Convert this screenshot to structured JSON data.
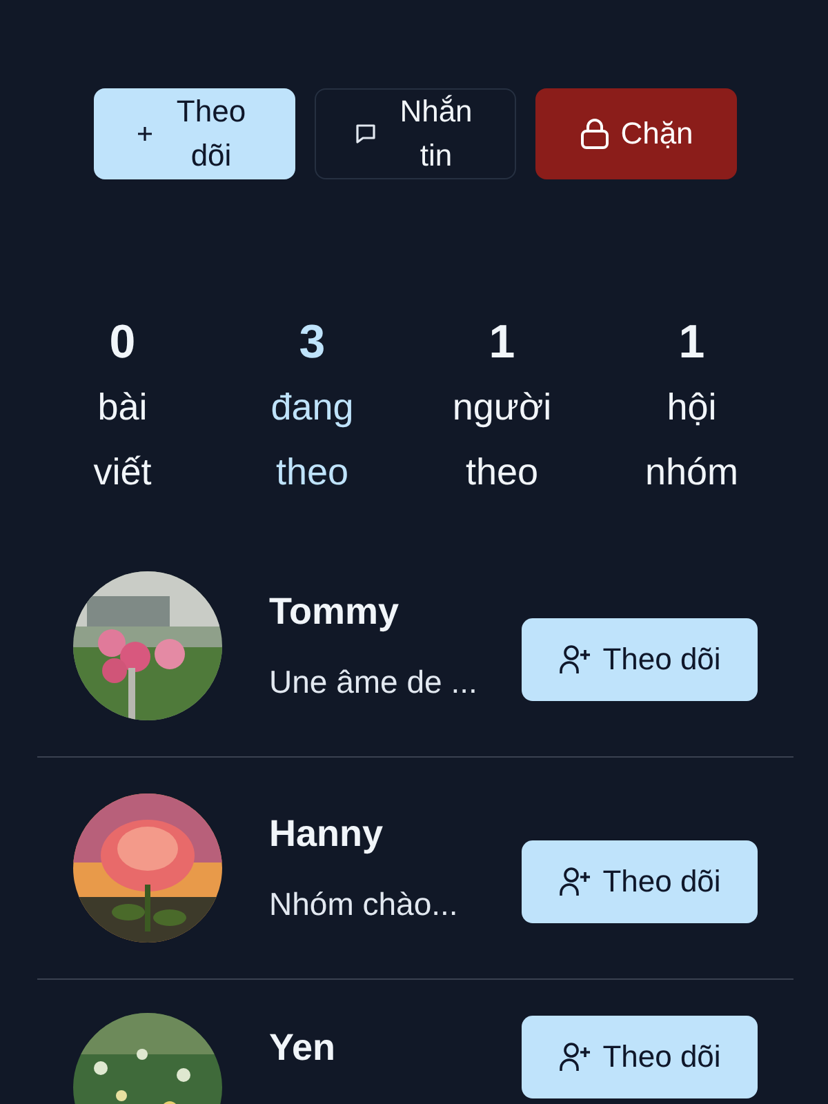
{
  "actions": [
    {
      "kind": "follow",
      "label": "Theo dõi"
    },
    {
      "kind": "message",
      "label": "Nhắn tin"
    },
    {
      "kind": "block",
      "label": "Chặn"
    }
  ],
  "stats": [
    {
      "count": "0",
      "label": "bài viết",
      "selected": false
    },
    {
      "count": "3",
      "label": "đang theo",
      "selected": true
    },
    {
      "count": "1",
      "label": "người theo",
      "selected": false
    },
    {
      "count": "1",
      "label": "hội nhóm",
      "selected": false
    }
  ],
  "users": [
    {
      "name": "Tommy",
      "bio": "Une âme de ...",
      "button": "Theo dõi"
    },
    {
      "name": "Hanny",
      "bio": "Nhóm chào...",
      "button": "Theo dõi"
    },
    {
      "name": "Yen",
      "button": "Theo dõi"
    }
  ]
}
